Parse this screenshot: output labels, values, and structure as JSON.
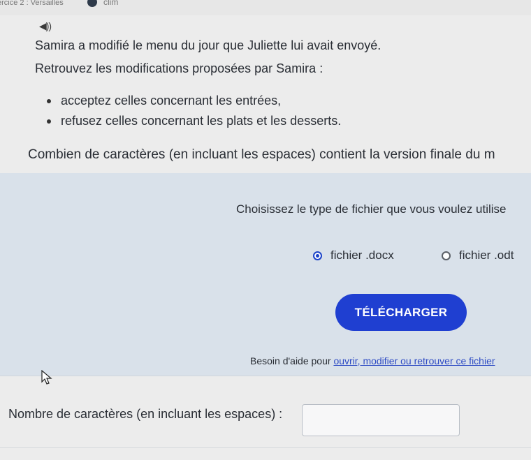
{
  "topbar": {
    "breadcrumb": "ercice 2 : Versailles",
    "app_label": "clim"
  },
  "audio_icon_glyph": "◀))",
  "instructions": {
    "line1": "Samira a modifié le menu du jour que Juliette lui avait envoyé.",
    "line2": "Retrouvez les modifications proposées par Samira :",
    "bullets": [
      "acceptez celles concernant les entrées,",
      "refusez celles concernant les plats et les desserts."
    ],
    "question": "Combien de caractères (en incluant les espaces) contient la version finale du m"
  },
  "download_panel": {
    "title": "Choisissez le type de fichier que vous voulez utilise",
    "options": [
      {
        "label": "fichier .docx",
        "selected": true
      },
      {
        "label": "fichier .odt",
        "selected": false
      }
    ],
    "button_label": "TÉLÉCHARGER",
    "help_prefix": "Besoin d'aide pour ",
    "help_link": "ouvrir, modifier ou retrouver ce fichier"
  },
  "answer": {
    "label": "Nombre de caractères (en incluant les espaces) :",
    "value": "",
    "placeholder": ""
  },
  "colors": {
    "accent": "#1f3fd1",
    "panel_bg": "#d9e1ea",
    "link": "#2f4cc4"
  }
}
